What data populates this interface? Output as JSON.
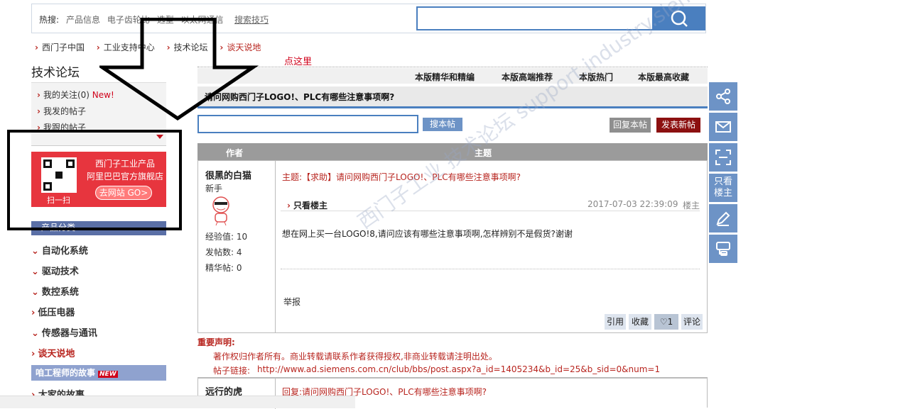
{
  "topbar": {
    "hot_label": "热搜:",
    "hot_links": [
      "产品信息",
      "电子齿轮比",
      "选型",
      "以太网通信"
    ],
    "search_tips": "搜索技巧"
  },
  "breadcrumb": [
    "西门子中国",
    "工业支持中心",
    "技术论坛",
    "谈天说地"
  ],
  "annotation": {
    "click_here": "点这里"
  },
  "sidebar": {
    "title": "技术论坛",
    "my_items": [
      {
        "label": "我的关注(0)",
        "badge": "New!"
      },
      {
        "label": "我发的帖子"
      },
      {
        "label": "我跟的帖子"
      }
    ],
    "banner": {
      "line1": "西门子工业产品",
      "line2": "阿里巴巴官方旗舰店",
      "button": "去网站 GO>",
      "scan": "扫一扫"
    },
    "category_header": "产品分类",
    "categories": [
      "自动化系统",
      "驱动技术",
      "数控系统",
      "低压电器",
      "传感器与通讯",
      "谈天说地"
    ],
    "engineer_story": "咱工程师的故事",
    "new_tag": "NEW",
    "family_story": "大家的故事"
  },
  "main": {
    "tabs": [
      "本版精华和精编",
      "本版高端推荐",
      "本版热门",
      "本版最高收藏"
    ],
    "post_title": "请问网购西门子LOGO!、PLC有哪些注意事项啊?",
    "search_post_btn": "搜本帖",
    "reply_btn": "回复本帖",
    "new_post_btn": "发表新帖",
    "th_author": "作者",
    "th_subject": "主题",
    "post": {
      "author": "很黑的白猫",
      "rank": "新手",
      "stats": [
        "经验值: 10",
        "发帖数: 4",
        "精华帖: 0"
      ],
      "subject": "主题:【求助】请问网购西门子LOGO!、PLC有哪些注意事项啊?",
      "only_op": "只看楼主",
      "time": "2017-07-03 22:39:09",
      "floor": "楼主",
      "body": "想在网上买一台LOGO!8,请问应该有哪些注意事项啊,怎样辨别不是假货?谢谢",
      "report": "举报",
      "actions": {
        "quote": "引用",
        "fav": "收藏",
        "like_count": "1",
        "comment": "评论"
      }
    },
    "watermark": "西门子工业 技术论坛 support.industry.siemens.com/cs",
    "declaration": {
      "title": "重要声明:",
      "copyright": "著作权归作者所有。商业转载请联系作者获得授权,非商业转载请注明出处。",
      "link_label": "帖子链接:",
      "link_url": "http://www.ad.siemens.com.cn/club/bbs/post.aspx?a_id=1405234&b_id=25&b_sid=0&num=1"
    },
    "reply": {
      "author": "远行的虎",
      "subject": "回复:请问网购西门子LOGO!、PLC有哪些注意事项啊?"
    }
  },
  "float_bar": {
    "op_label": "只看楼主"
  },
  "colors": {
    "accent": "#4a7fbf",
    "brand_red": "#b8251f",
    "highlight_box": "#000000"
  }
}
